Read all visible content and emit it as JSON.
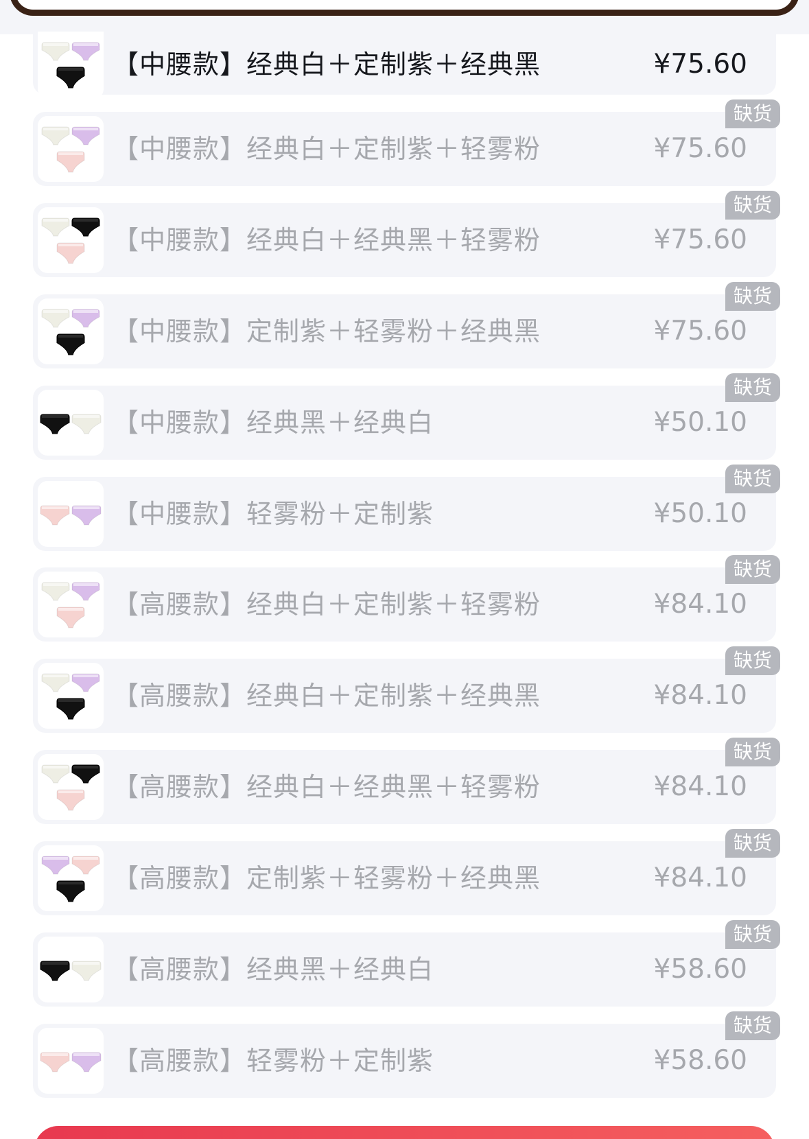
{
  "colors": {
    "page_background": "#ffffff",
    "row_background": "#f4f5f9",
    "text_available": "#16181d",
    "text_unavailable": "#a6a8ad",
    "badge_background": "#b5b7bd",
    "badge_text": "#ffffff",
    "frame_brown": "#3a2216",
    "button_red": "#e8394f",
    "swatch_white": "#eeeee4",
    "swatch_purple": "#d9bdea",
    "swatch_black": "#111111",
    "swatch_pink": "#f6d3d0"
  },
  "options": [
    {
      "label": "【中腰款】经典白＋定制紫＋经典黑",
      "price": "¥75.60",
      "badge": "",
      "available": true,
      "swatches": [
        "white",
        "purple",
        "black"
      ]
    },
    {
      "label": "【中腰款】经典白＋定制紫＋轻雾粉",
      "price": "¥75.60",
      "badge": "缺货",
      "available": false,
      "swatches": [
        "white",
        "purple",
        "pink"
      ]
    },
    {
      "label": "【中腰款】经典白＋经典黑＋轻雾粉",
      "price": "¥75.60",
      "badge": "缺货",
      "available": false,
      "swatches": [
        "white",
        "black",
        "pink"
      ]
    },
    {
      "label": "【中腰款】定制紫＋轻雾粉＋经典黑",
      "price": "¥75.60",
      "badge": "缺货",
      "available": false,
      "swatches": [
        "white",
        "purple",
        "black"
      ]
    },
    {
      "label": "【中腰款】经典黑＋经典白",
      "price": "¥50.10",
      "badge": "缺货",
      "available": false,
      "swatches": [
        "black",
        "white"
      ]
    },
    {
      "label": "【中腰款】轻雾粉＋定制紫",
      "price": "¥50.10",
      "badge": "缺货",
      "available": false,
      "swatches": [
        "pink",
        "purple"
      ]
    },
    {
      "label": "【高腰款】经典白＋定制紫＋轻雾粉",
      "price": "¥84.10",
      "badge": "缺货",
      "available": false,
      "swatches": [
        "white",
        "purple",
        "pink"
      ]
    },
    {
      "label": "【高腰款】经典白＋定制紫＋经典黑",
      "price": "¥84.10",
      "badge": "缺货",
      "available": false,
      "swatches": [
        "white",
        "purple",
        "black"
      ]
    },
    {
      "label": "【高腰款】经典白＋经典黑＋轻雾粉",
      "price": "¥84.10",
      "badge": "缺货",
      "available": false,
      "swatches": [
        "white",
        "black",
        "pink"
      ]
    },
    {
      "label": "【高腰款】定制紫＋轻雾粉＋经典黑",
      "price": "¥84.10",
      "badge": "缺货",
      "available": false,
      "swatches": [
        "purple",
        "pink",
        "black"
      ]
    },
    {
      "label": "【高腰款】经典黑＋经典白",
      "price": "¥58.60",
      "badge": "缺货",
      "available": false,
      "swatches": [
        "black",
        "white"
      ]
    },
    {
      "label": "【高腰款】轻雾粉＋定制紫",
      "price": "¥58.60",
      "badge": "缺货",
      "available": false,
      "swatches": [
        "pink",
        "purple"
      ]
    }
  ]
}
